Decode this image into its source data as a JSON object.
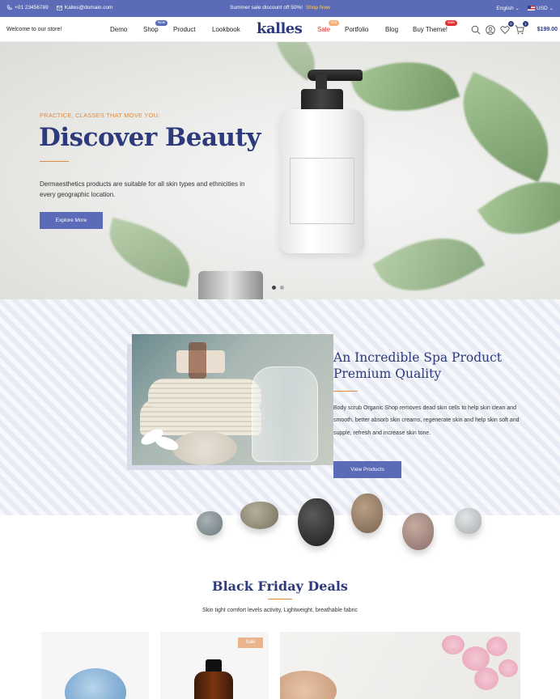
{
  "topbar": {
    "phone": "+01 23456789",
    "email": "Kalles@domain.com",
    "promo_text": "Summer sale discount off 50%!",
    "promo_link": "Shop Now",
    "language": "English",
    "currency": "USD"
  },
  "header": {
    "welcome": "Welcome to our store!",
    "logo": "kalles",
    "nav_left": [
      {
        "label": "Demo",
        "badge": ""
      },
      {
        "label": "Shop",
        "badge": "New"
      },
      {
        "label": "Product",
        "badge": ""
      },
      {
        "label": "Lookbook",
        "badge": ""
      }
    ],
    "nav_right": [
      {
        "label": "Sale",
        "badge": "Hot"
      },
      {
        "label": "Portfolio",
        "badge": ""
      },
      {
        "label": "Blog",
        "badge": ""
      },
      {
        "label": "Buy Theme!",
        "badge": "Sale"
      }
    ],
    "wishlist_count": "0",
    "cart_count": "1",
    "cart_total": "$199.00",
    "icons": [
      "search-icon",
      "account-icon",
      "heart-icon",
      "cart-icon"
    ]
  },
  "hero": {
    "tagline": "PRACTICE, CLASSES THAT MOVE YOU:",
    "title": "Discover Beauty",
    "description": "Dermaesthetics products are suitable for all skin types and ethnicities in every geographic location.",
    "button": "Explore More",
    "slides_total": 2,
    "active_slide": 1
  },
  "spa": {
    "title_line1": "An Incredible Spa Product",
    "title_line2": "Premium Quality",
    "description": "Body scrub Organic Shop removes dead skin cells to help skin clean and smooth, better absorb skin creams, regenerate skin and help skin soft and supple, refresh and increase skin tone.",
    "button": "View Products"
  },
  "deals": {
    "title": "Black Friday Deals",
    "subtitle": "Skin tight comfort levels activity, Lightweight, breathable fabric",
    "sale_badge": "Sale"
  },
  "colors": {
    "primary": "#5b6bb7",
    "navy": "#2d3a7c",
    "accent": "#e08a40",
    "sale_red": "#e03030"
  }
}
